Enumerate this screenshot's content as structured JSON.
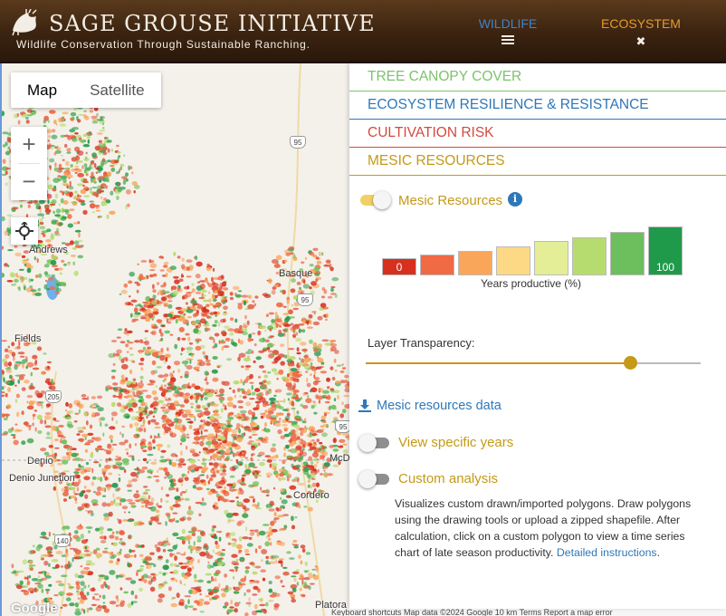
{
  "header": {
    "title": "SAGE GROUSE INITIATIVE",
    "tagline": "Wildlife Conservation Through Sustainable Ranching.",
    "nav": {
      "wildlife_label": "WILDLIFE",
      "ecosystem_label": "ECOSYSTEM",
      "wildlife_icon": "list-icon",
      "ecosystem_icon": "close-icon",
      "ecosystem_sub": "✖"
    }
  },
  "map": {
    "type_controls": {
      "map_label": "Map",
      "satellite_label": "Satellite"
    },
    "zoom_in": "+",
    "zoom_out": "−",
    "places": {
      "andrews": "Andrews",
      "basque": "Basque",
      "fields": "Fields",
      "denio": "Denio",
      "denio_junction": "Denio Junction",
      "cordero": "Cordero",
      "mcdermitt": "McDer",
      "platora": "Platora"
    },
    "highways": {
      "h95a": "95",
      "h95b": "95",
      "h205": "205",
      "h140": "140",
      "h95c": "95"
    },
    "google": "Google",
    "attribution": "Keyboard shortcuts  Map data ©2024 Google  10 km  Terms  Report a map error"
  },
  "panel": {
    "tabs": {
      "tree_canopy": "TREE CANOPY COVER",
      "resilience": "ECOSYSTEM RESILIENCE & RESISTANCE",
      "cultivation": "CULTIVATION RISK",
      "mesic": "MESIC RESOURCES"
    },
    "mesic_toggle": {
      "label": "Mesic Resources",
      "on": true
    },
    "legend": {
      "caption": "Years productive (%)",
      "min_label": "0",
      "max_label": "100",
      "colors": [
        "#d7301f",
        "#f06a43",
        "#f9a65a",
        "#fdd985",
        "#e3ee96",
        "#b6dc6f",
        "#6cbf5c",
        "#1f9a4b"
      ],
      "heights_fraction": [
        0.35,
        0.42,
        0.5,
        0.6,
        0.7,
        0.78,
        0.88,
        1.0
      ]
    },
    "transparency": {
      "label": "Layer Transparency:",
      "value": 0.79
    },
    "data_link": "Mesic resources data",
    "specific_years": {
      "label": "View specific years",
      "on": false
    },
    "custom_analysis": {
      "label": "Custom analysis",
      "on": false
    },
    "description": "Visualizes custom drawn/imported polygons. Draw polygons using the drawing tools or upload a zipped shapefile. After calculation, click on a custom polygon to view a time series chart of late season productivity.",
    "instructions_link": "Detailed instructions",
    "instructions_tail": "."
  },
  "colors": {
    "header_brown": "#3b2310",
    "green": "#7cc36b",
    "blue": "#2e78b8",
    "red": "#d14a3f",
    "gold": "#c49a16"
  }
}
